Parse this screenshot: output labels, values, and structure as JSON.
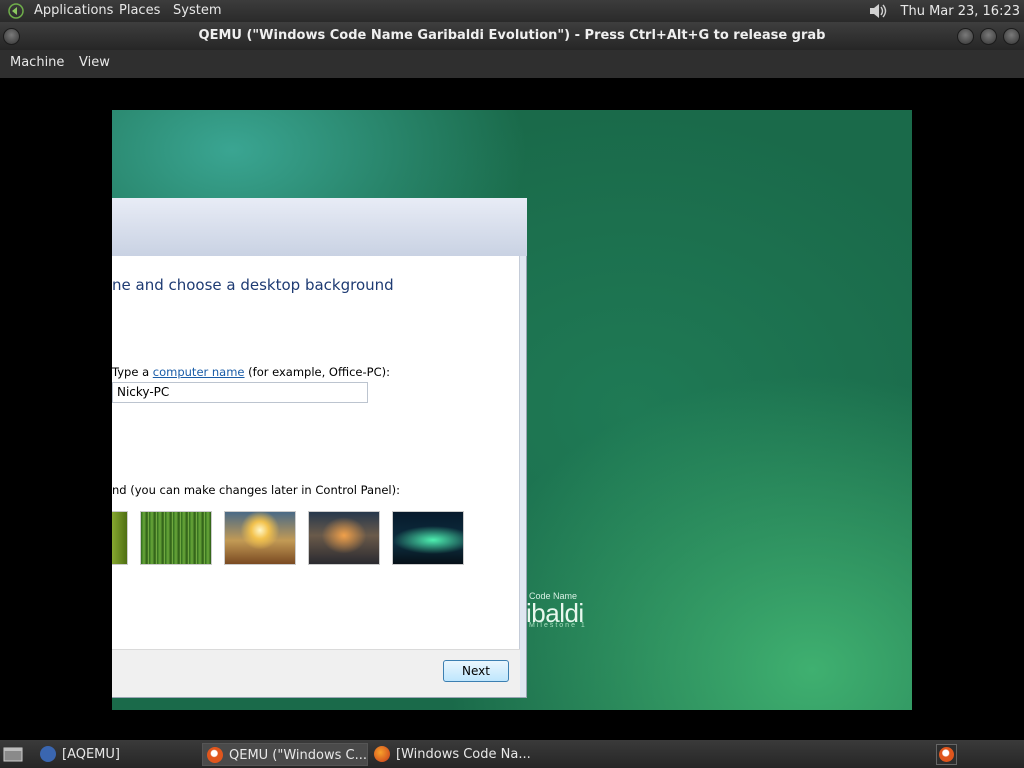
{
  "top_panel": {
    "menus": [
      "Applications",
      "Places",
      "System"
    ],
    "clock": "Thu Mar 23, 16:23",
    "icons": {
      "apps": "gnome-foot-icon",
      "volume": "volume-icon"
    }
  },
  "window": {
    "title": "QEMU (\"Windows Code Name Garibaldi Evolution\") - Press Ctrl+Alt+G to release grab",
    "menus": [
      "Machine",
      "View"
    ]
  },
  "guest": {
    "brand_small": "Code Name",
    "brand_big": "ibaldi",
    "brand_milestone": "Milestone 1",
    "dialog": {
      "heading": "ne and choose a desktop background",
      "name_label_prefix": "Type a ",
      "name_label_link": "computer name",
      "name_label_suffix": " (for example, Office-PC):",
      "computer_name": "Nicky-PC",
      "background_label": "nd (you can make changes later in Control Panel):",
      "next_label": "Next"
    }
  },
  "taskbar": {
    "items": [
      {
        "label": "[AQEMU]",
        "icon": "aqemu-icon"
      },
      {
        "label": "QEMU (\"Windows C...",
        "icon": "qemu-icon"
      },
      {
        "label": "[Windows Code Na...",
        "icon": "firefox-icon"
      }
    ]
  },
  "colors": {
    "panel": "#2a2a2a",
    "guest_bg": "#1a6a4a",
    "dialog_heading": "#1e3b73",
    "link": "#1a5da8"
  }
}
